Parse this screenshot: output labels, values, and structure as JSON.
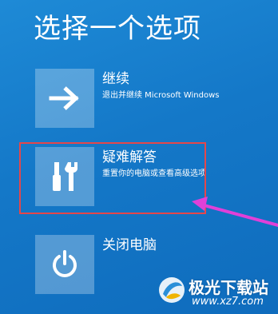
{
  "screen": {
    "title": "选择一个选项"
  },
  "options": [
    {
      "label": "继续",
      "description": "退出并继续 Microsoft Windows",
      "icon": "arrow-right-icon"
    },
    {
      "label": "疑难解答",
      "description": "重置你的电脑或查看高级选项",
      "icon": "tools-icon"
    },
    {
      "label": "关闭电脑",
      "description": "",
      "icon": "power-icon"
    }
  ],
  "annotation": {
    "highlight_color": "#e5474a",
    "arrow_color": "#e040d8"
  },
  "watermark": {
    "name": "极光下载站",
    "url": "www.xz7.com"
  }
}
